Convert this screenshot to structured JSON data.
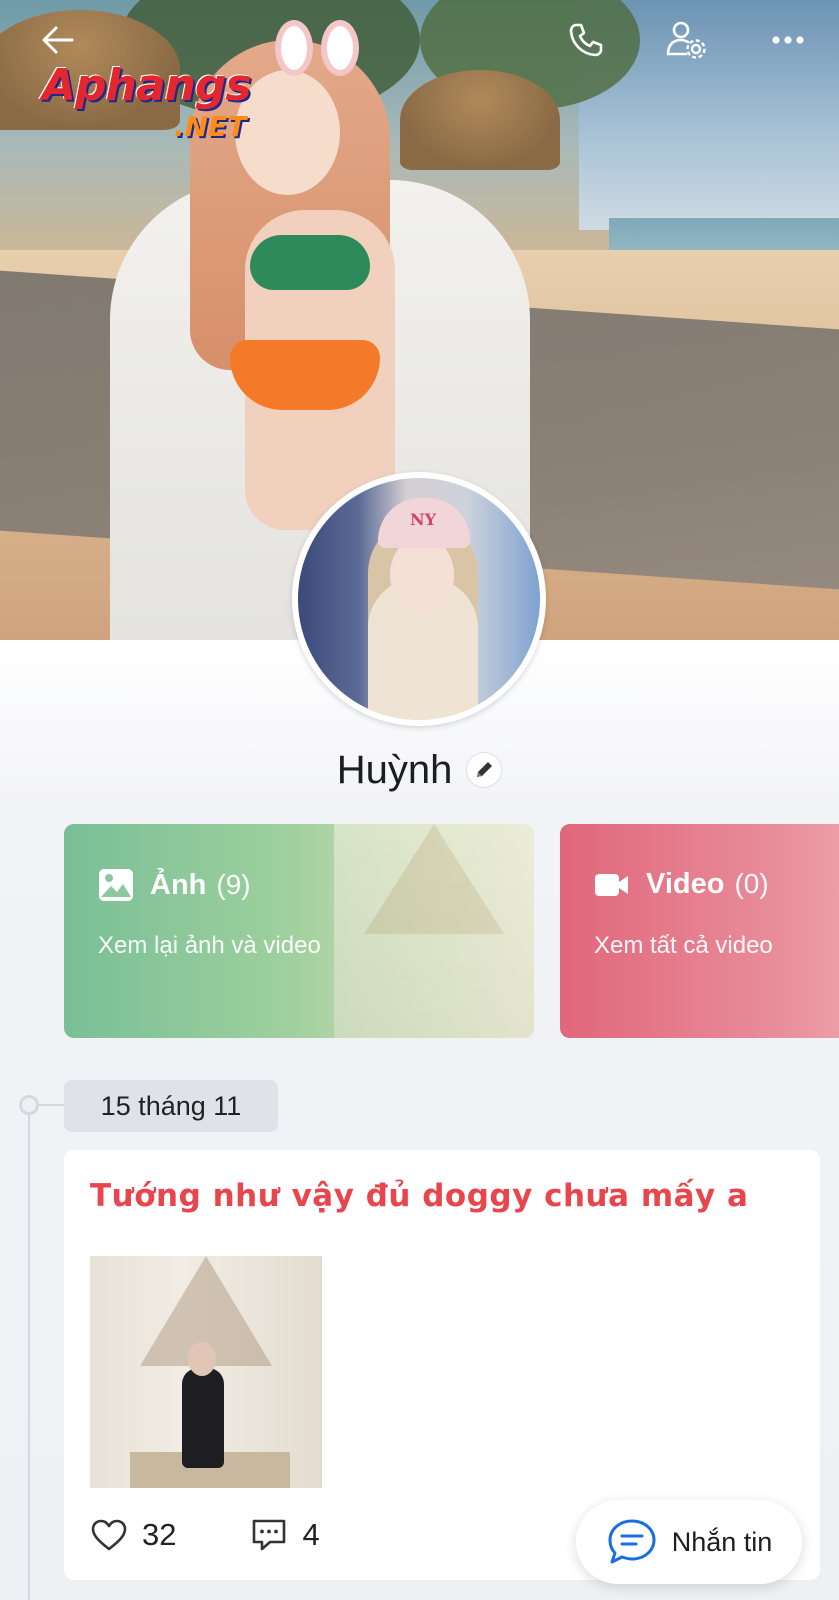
{
  "watermark": {
    "main": "Aphangs",
    "sub": ".NET"
  },
  "topbar": {
    "back_icon": "arrow-left-icon",
    "call_icon": "phone-icon",
    "settings_icon": "user-settings-icon",
    "more_icon": "more-horizontal-icon"
  },
  "profile": {
    "name": "Huỳnh",
    "edit_icon": "pencil-icon"
  },
  "media": {
    "photos": {
      "title": "Ảnh",
      "count": "(9)",
      "subtitle": "Xem lại ảnh và video",
      "icon": "image-icon"
    },
    "videos": {
      "title": "Video",
      "count": "(0)",
      "subtitle": "Xem tất cả video",
      "icon": "video-camera-icon"
    }
  },
  "timeline": {
    "date": "15 tháng 11"
  },
  "post": {
    "text": "Tướng như vậy đủ doggy chưa mấy a",
    "likes": "32",
    "comments": "4",
    "like_icon": "heart-icon",
    "comment_icon": "comment-icon"
  },
  "message_button": {
    "label": "Nhắn tin",
    "icon": "chat-bubble-icon"
  },
  "colors": {
    "accent_blue": "#1a6fe0",
    "photos_card": "#79bf97",
    "videos_card": "#e0677b",
    "post_text": "#e8454d"
  }
}
